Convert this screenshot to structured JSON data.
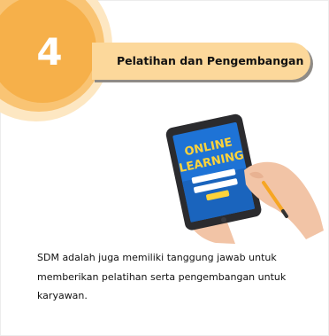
{
  "step": {
    "number": "4",
    "title": "Pelatihan dan Pengembangan"
  },
  "illustration": {
    "tablet_screen_text": [
      "ONLINE",
      "LEARNING"
    ],
    "icon": "tablet-online-learning-illustration"
  },
  "description": "SDM adalah juga memiliki tanggung jawab untuk memberikan pelatihan serta pengembangan untuk karyawan.",
  "colors": {
    "circle_outer": "#fde7c2",
    "circle_mid": "#f9c474",
    "circle_inner": "#f6b04a",
    "pill": "#fcd89b",
    "tablet_screen": "#1e73d6"
  }
}
